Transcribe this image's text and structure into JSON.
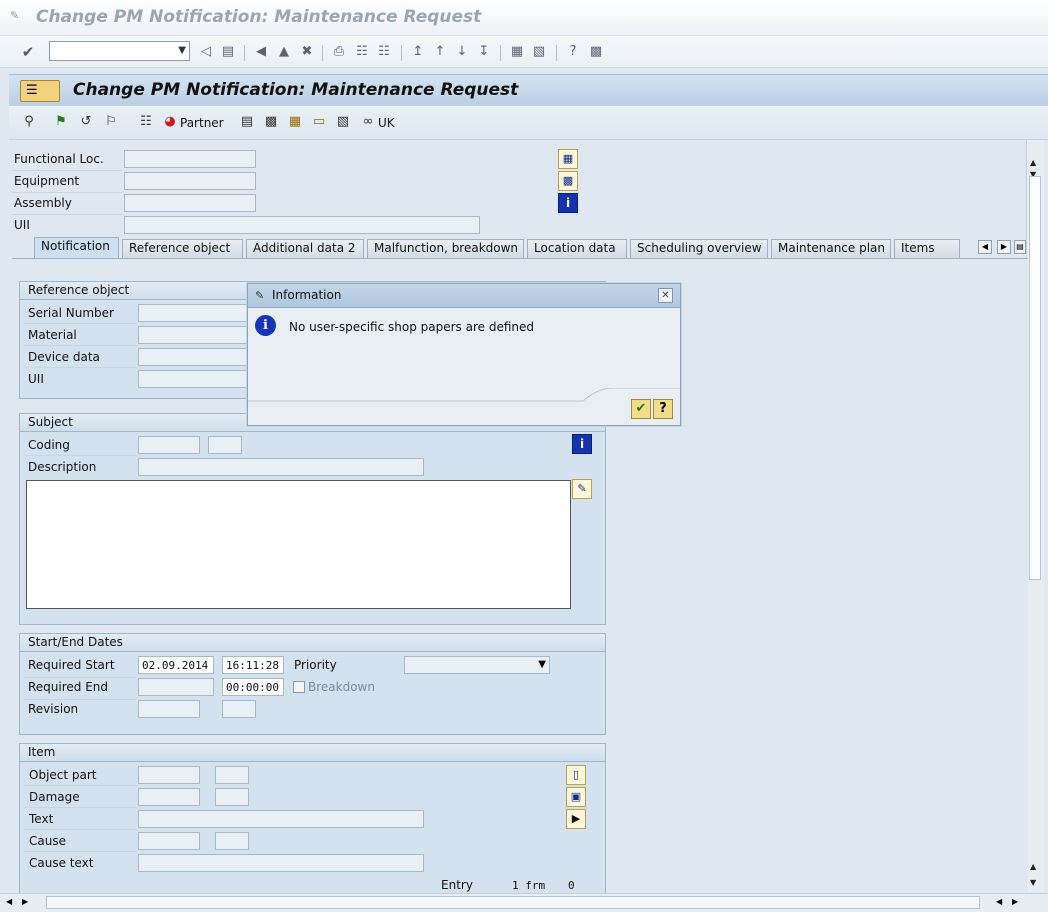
{
  "window": {
    "title": "Change PM Notification: Maintenance Request"
  },
  "command_field": {
    "value": ""
  },
  "screen": {
    "title": "Change PM Notification: Maintenance Request"
  },
  "app_toolbar": {
    "partner_label": "Partner",
    "uk_label": "UK"
  },
  "header_fields": [
    {
      "label": "Functional Loc.",
      "value": ""
    },
    {
      "label": "Equipment",
      "value": ""
    },
    {
      "label": "Assembly",
      "value": ""
    },
    {
      "label": "UII",
      "value": ""
    }
  ],
  "tabs": [
    {
      "label": "Notification",
      "active": true
    },
    {
      "label": "Reference object"
    },
    {
      "label": "Additional data 2"
    },
    {
      "label": "Malfunction, breakdown"
    },
    {
      "label": "Location data"
    },
    {
      "label": "Scheduling overview"
    },
    {
      "label": "Maintenance plan"
    },
    {
      "label": "Items"
    }
  ],
  "reference_object": {
    "title": "Reference object",
    "fields": [
      {
        "label": "Serial Number"
      },
      {
        "label": "Material"
      },
      {
        "label": "Device data"
      },
      {
        "label": "UII"
      }
    ]
  },
  "subject": {
    "title": "Subject",
    "coding_label": "Coding",
    "description_label": "Description"
  },
  "dates": {
    "title": "Start/End Dates",
    "required_start_label": "Required Start",
    "required_start_date": "02.09.2014",
    "required_start_time": "16:11:28",
    "required_end_label": "Required End",
    "required_end_time": "00:00:00",
    "revision_label": "Revision",
    "priority_label": "Priority",
    "breakdown_label": "Breakdown"
  },
  "item": {
    "title": "Item",
    "object_part_label": "Object part",
    "damage_label": "Damage",
    "text_label": "Text",
    "cause_label": "Cause",
    "cause_text_label": "Cause text",
    "entry_label": "Entry",
    "entry_value": "1 frm",
    "entry_total": "0"
  },
  "dialog": {
    "title": "Information",
    "message": "No user-specific shop papers are defined"
  },
  "colors": {
    "accent": "#1634b5",
    "background": "#dfe8f1",
    "yellow_button": "#f3dc8a"
  }
}
